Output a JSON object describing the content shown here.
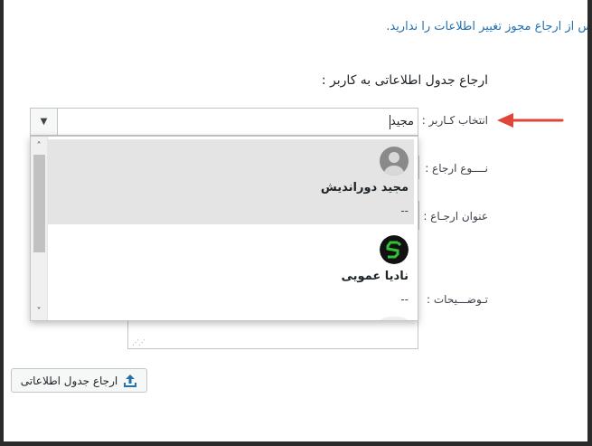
{
  "notice": "ﺲ از ارجاع مجوز تغییر اطلاعات را ندارید.",
  "section_title": "ارجاع جدول اطلاعاتی به کاربر :",
  "fields": {
    "user_label": "انتخاب کـاربر :",
    "type_label": "نــــوع ارجاع :",
    "title_label": "عنوان ارجـاع :",
    "desc_label": "تـوضـــیحات :"
  },
  "combo": {
    "value": "مجید",
    "toggle_icon": "triangle-down"
  },
  "dropdown": {
    "options": [
      {
        "name": "مجید دوراندیش",
        "sub": "--",
        "avatar": "default-person",
        "highlighted": true
      },
      {
        "name": "نادیا عمویی",
        "sub": "--",
        "avatar": "green-logo",
        "highlighted": false
      }
    ]
  },
  "submit": {
    "label": "ارجاع جدول اطلاعاتی",
    "icon": "upload-icon"
  },
  "colors": {
    "link": "#2271b1",
    "arrow": "#e0453a",
    "highlight": "#e4e4e4",
    "button_icon": "#2271b1"
  }
}
